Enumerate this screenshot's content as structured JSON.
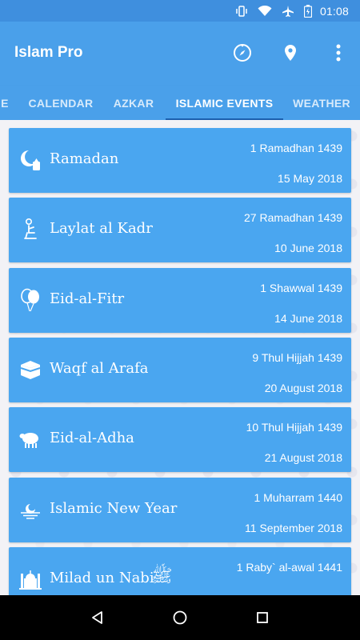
{
  "status_bar": {
    "time": "01:08"
  },
  "app": {
    "title": "Islam Pro"
  },
  "tabs": [
    {
      "label": "E"
    },
    {
      "label": "CALENDAR"
    },
    {
      "label": "AZKAR"
    },
    {
      "label": "ISLAMIC EVENTS"
    },
    {
      "label": "WEATHER"
    }
  ],
  "active_tab": "ISLAMIC EVENTS",
  "events": [
    {
      "name": "Ramadan",
      "hijri": "1 Ramadhan 1439",
      "date": "15 May 2018",
      "icon": "crescent-lantern-icon"
    },
    {
      "name": "Laylat al Kadr",
      "hijri": "27 Ramadhan 1439",
      "date": "10 June 2018",
      "icon": "praying-person-icon"
    },
    {
      "name": "Eid-al-Fitr",
      "hijri": "1 Shawwal 1439",
      "date": "14 June 2018",
      "icon": "balloons-icon"
    },
    {
      "name": "Waqf al Arafa",
      "hijri": "9 Thul Hijjah 1439",
      "date": "20 August 2018",
      "icon": "kaaba-icon"
    },
    {
      "name": "Eid-al-Adha",
      "hijri": "10 Thul Hijjah 1439",
      "date": "21 August 2018",
      "icon": "sheep-icon"
    },
    {
      "name": "Islamic New Year",
      "hijri": "1 Muharram 1440",
      "date": "11 September 2018",
      "icon": "crescent-horizon-icon"
    },
    {
      "name": "Milad un Nabi",
      "hijri": "1 Raby` al-awal 1441",
      "date": "",
      "icon": "mosque-icon",
      "calligraphy": "ﷺ"
    }
  ],
  "colors": {
    "primary": "#4aa0ea",
    "status_bar": "#3f8fde",
    "card": "#4aa6f0",
    "indicator": "#1c5fae"
  }
}
